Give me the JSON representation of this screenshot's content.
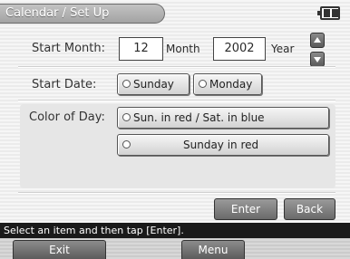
{
  "header": {
    "title": "Calendar / Set Up",
    "battery_icon": "battery-icon"
  },
  "start_month": {
    "label": "Start Month:",
    "month_value": "12",
    "month_unit": "Month",
    "year_value": "2002",
    "year_unit": "Year",
    "up_icon": "arrow-up-icon",
    "down_icon": "arrow-down-icon"
  },
  "start_date": {
    "label": "Start Date:",
    "options": [
      "Sunday",
      "Monday"
    ]
  },
  "color_of_day": {
    "label": "Color of Day:",
    "options": [
      "Sun. in red / Sat. in blue",
      "Sunday in red"
    ]
  },
  "actions": {
    "enter": "Enter",
    "back": "Back"
  },
  "status": "Select an item and then tap [Enter].",
  "softkeys": {
    "left": "Exit",
    "right": "Menu"
  }
}
